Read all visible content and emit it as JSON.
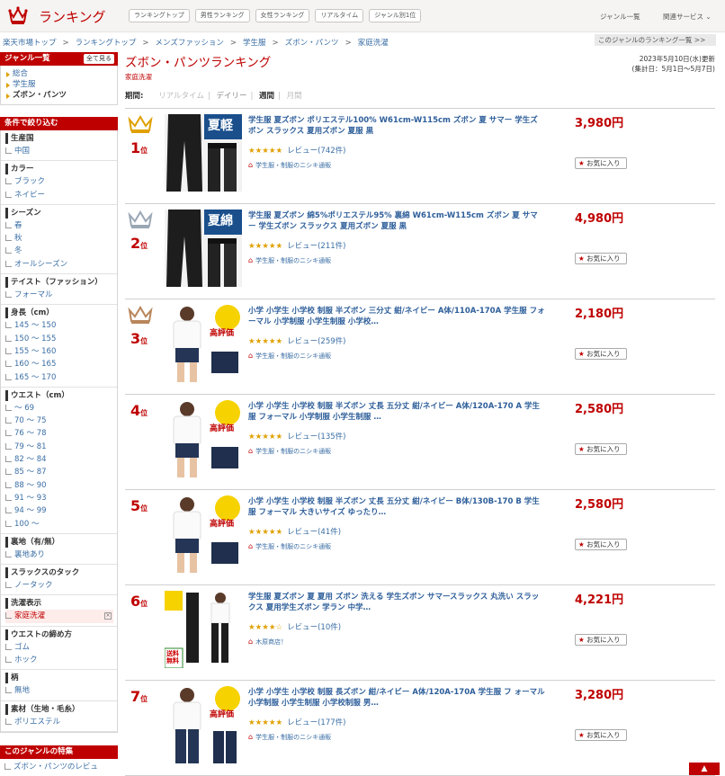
{
  "header": {
    "brand": "ランキング",
    "tabs": [
      "ランキングトップ",
      "男性ランキング",
      "女性ランキング",
      "リアルタイム",
      "ジャンル別1位"
    ],
    "genre_list": "ジャンル一覧",
    "related": "関連サービス"
  },
  "breadcrumb": [
    "楽天市場トップ",
    "ランキングトップ",
    "メンズファッション",
    "学生服",
    "ズボン・パンツ",
    "家庭洗濯"
  ],
  "genre_ranking_link": "このジャンルのランキング一覧 >>",
  "sidebar": {
    "genre_title": "ジャンル一覧",
    "all_button": "全て見る",
    "genres": [
      "総合",
      "学生服",
      "ズボン・パンツ"
    ],
    "filter_title": "条件で絞り込む",
    "groups": [
      {
        "title": "生産国",
        "items": [
          "中国"
        ]
      },
      {
        "title": "カラー",
        "items": [
          "ブラック",
          "ネイビー"
        ]
      },
      {
        "title": "シーズン",
        "items": [
          "春",
          "秋",
          "冬",
          "オールシーズン"
        ]
      },
      {
        "title": "テイスト（ファッション）",
        "items": [
          "フォーマル"
        ]
      },
      {
        "title": "身長（cm）",
        "items": [
          "145 〜 150",
          "150 〜 155",
          "155 〜 160",
          "160 〜 165",
          "165 〜 170"
        ]
      },
      {
        "title": "ウエスト（cm）",
        "items": [
          "〜 69",
          "70 〜 75",
          "76 〜 78",
          "79 〜 81",
          "82 〜 84",
          "85 〜 87",
          "88 〜 90",
          "91 〜 93",
          "94 〜 99",
          "100 〜"
        ]
      },
      {
        "title": "裏地（有/無）",
        "items": [
          "裏地あり"
        ]
      },
      {
        "title": "スラックスのタック",
        "items": [
          "ノータック"
        ]
      },
      {
        "title": "洗濯表示",
        "items": [
          "家庭洗濯"
        ],
        "selected": "家庭洗濯"
      },
      {
        "title": "ウエストの締め方",
        "items": [
          "ゴム",
          "ホック"
        ]
      },
      {
        "title": "柄",
        "items": [
          "無地"
        ]
      },
      {
        "title": "素材（生地・毛糸）",
        "items": [
          "ポリエステル"
        ]
      }
    ],
    "feature_title": "このジャンルの特集",
    "feature_item": "ズボン・パンツのレビュ"
  },
  "main": {
    "title": "ズボン・パンツランキング",
    "subcategory": "家庭洗濯",
    "updated": "2023年5月10日(水)更新",
    "period_range": "(集計日：5月1日〜5月7日)",
    "period_label": "期間:",
    "periods": [
      "リアルタイム",
      "デイリー",
      "週間",
      "月間"
    ],
    "current_period": "週間"
  },
  "items": [
    {
      "rank": "1",
      "suffix": "位",
      "name": "学生服 夏ズボン ポリエステル100% W61cm-W115cm ズボン 夏 サマー 学生ズボン スラックス 夏用ズボン 夏服 黒",
      "stars": "★★★★★",
      "reviews": "レビュー(742件)",
      "shop": "学生服・制服のニシキ通販",
      "price": "3,980円",
      "fav": "お気に入り",
      "crown": "#e0a000",
      "img": "black-summer",
      "badge": "夏軽"
    },
    {
      "rank": "2",
      "suffix": "位",
      "name": "学生服 夏ズボン 綿5%ポリエステル95% 裏綿 W61cm-W115cm ズボン 夏 サマー 学生ズボン スラックス 夏用ズボン 夏服 黒",
      "stars": "★★★★★",
      "reviews": "レビュー(211件)",
      "shop": "学生服・制服のニシキ通販",
      "price": "4,980円",
      "fav": "お気に入り",
      "crown": "#9aa7b5",
      "img": "black-summer",
      "badge": "夏綿"
    },
    {
      "rank": "3",
      "suffix": "位",
      "name": "小学 小学生 小学校 制服 半ズボン 三分丈 紺/ネイビー A体/110A-170A 学生服 フォーマル 小学制服 小学生制服 小学校…",
      "stars": "★★★★★",
      "reviews": "レビュー(259件)",
      "shop": "学生服・制服のニシキ通販",
      "price": "2,180円",
      "fav": "お気に入り",
      "crown": "#b8865b",
      "img": "navy-shorts",
      "badge": "高評価"
    },
    {
      "rank": "4",
      "suffix": "位",
      "name": "小学 小学生 小学校 制服 半ズボン 丈長 五分丈 紺/ネイビー A体/120A-170 A 学生服 フォーマル 小学制服 小学生制服 …",
      "stars": "★★★★★",
      "reviews": "レビュー(135件)",
      "shop": "学生服・制服のニシキ通販",
      "price": "2,580円",
      "fav": "お気に入り",
      "crown": "",
      "img": "navy-shorts",
      "badge": "高評価"
    },
    {
      "rank": "5",
      "suffix": "位",
      "name": "小学 小学生 小学校 制服 半ズボン 丈長 五分丈 紺/ネイビー B体/130B-170 B 学生服 フォーマル 大きいサイズ ゆったり…",
      "stars": "★★★★★",
      "reviews": "レビュー(41件)",
      "shop": "学生服・制服のニシキ通販",
      "price": "2,580円",
      "fav": "お気に入り",
      "crown": "",
      "img": "navy-shorts",
      "badge": "高評価"
    },
    {
      "rank": "6",
      "suffix": "位",
      "name": "学生服 夏ズボン 夏 夏用 ズボン 洗える 学生ズボン サマースラックス 丸洗い スラックス 夏用学生ズボン 学ラン 中学…",
      "stars": "★★★★☆",
      "reviews": "レビュー(10件)",
      "shop": "木原商店！",
      "price": "4,221円",
      "fav": "お気に入り",
      "crown": "",
      "img": "standing",
      "badge": "送料無料"
    },
    {
      "rank": "7",
      "suffix": "位",
      "name": "小学 小学生 小学校 制服 長ズボン 紺/ネイビー A体/120A-170A 学生服 フ ォーマル 小学制服 小学生制服 小学校制服 男…",
      "stars": "★★★★★",
      "reviews": "レビュー(177件)",
      "shop": "学生服・制服のニシキ通販",
      "price": "3,280円",
      "fav": "お気に入り",
      "crown": "",
      "img": "navy-long",
      "badge": "高評価"
    }
  ],
  "totop": "▲"
}
